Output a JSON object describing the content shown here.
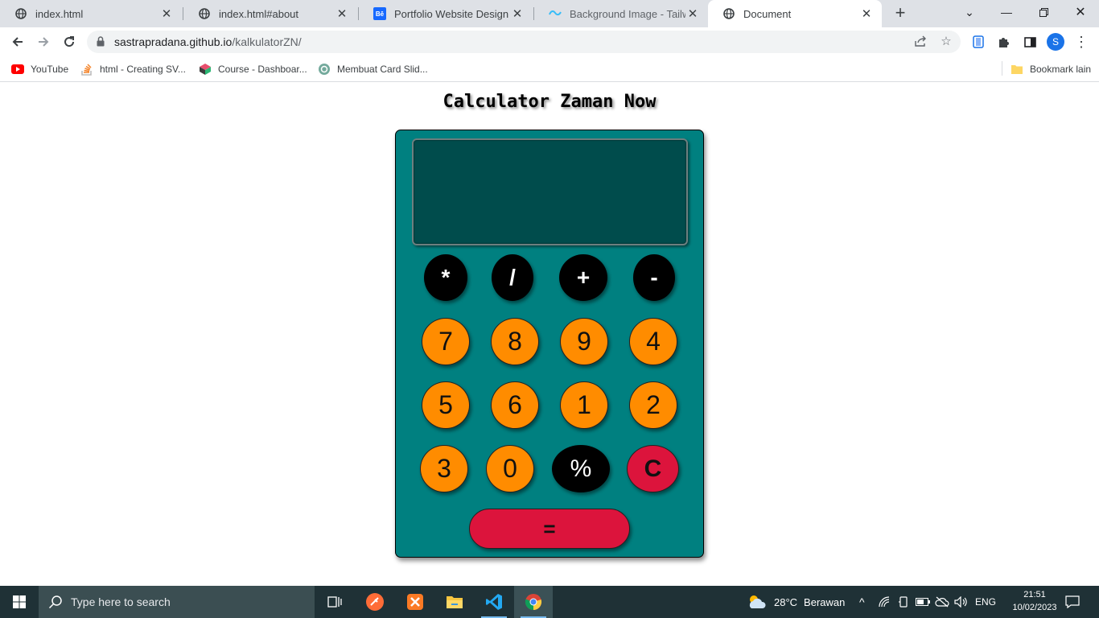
{
  "browser": {
    "tabs": [
      {
        "label": "index.html",
        "icon": "globe-icon",
        "active": false
      },
      {
        "label": "index.html#about",
        "icon": "globe-icon",
        "active": false
      },
      {
        "label": "Portfolio Website Design on B",
        "icon": "behance-icon",
        "active": false
      },
      {
        "label": "Background Image - Tailwind",
        "icon": "tailwind-icon",
        "active": false
      },
      {
        "label": "Document",
        "icon": "globe-icon",
        "active": true
      }
    ],
    "url_host": "sastrapradana.github.io",
    "url_path": "/kalkulatorZN/",
    "profile_initial": "S",
    "bookmarks": [
      {
        "label": "YouTube",
        "icon": "youtube-icon"
      },
      {
        "label": "html - Creating SV...",
        "icon": "stackoverflow-icon"
      },
      {
        "label": "Course - Dashboar...",
        "icon": "cube-icon"
      },
      {
        "label": "Membuat Card Slid...",
        "icon": "openai-icon"
      }
    ],
    "other_bookmarks": "Bookmark lain"
  },
  "calculator": {
    "title": "Calculator Zaman Now",
    "display_value": "",
    "keys": {
      "multiply": "*",
      "divide": "/",
      "plus": "+",
      "minus": "-",
      "seven": "7",
      "eight": "8",
      "nine": "9",
      "four": "4",
      "five": "5",
      "six": "6",
      "one": "1",
      "two": "2",
      "three": "3",
      "zero": "0",
      "percent": "%",
      "clear": "C",
      "equals": "="
    },
    "colors": {
      "body": "#008080",
      "display": "#004c4c",
      "number_key": "#ff8c00",
      "operator_key": "#000000",
      "clear_key": "#dc143c"
    }
  },
  "taskbar": {
    "search_placeholder": "Type here to search",
    "weather_temp": "28°C",
    "weather_text": "Berawan",
    "language": "ENG",
    "time": "21:51",
    "date": "10/02/2023"
  }
}
